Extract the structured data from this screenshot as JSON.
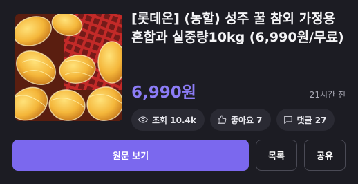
{
  "product": {
    "title": "[롯데온] (농할) 성주 꿀 참외 가정용 혼합과 실중량10kg (6,990원/무료)",
    "image_alt": "참외 사진",
    "price": "6,990원",
    "posted_ago": "21시간 전"
  },
  "stats": {
    "views_label": "조회 10.4k",
    "likes_label": "좋아요 7",
    "comments_label": "댓글 27"
  },
  "actions": {
    "view_original": "원문 보기",
    "list": "목록",
    "share": "공유"
  },
  "icons": {
    "views": "eye-icon",
    "likes": "thumbs-up-icon",
    "comments": "comment-icon"
  },
  "colors": {
    "accent": "#7b68ee",
    "price": "#8c7cf6",
    "background": "#1c1c23",
    "chip": "#2a2a33"
  }
}
